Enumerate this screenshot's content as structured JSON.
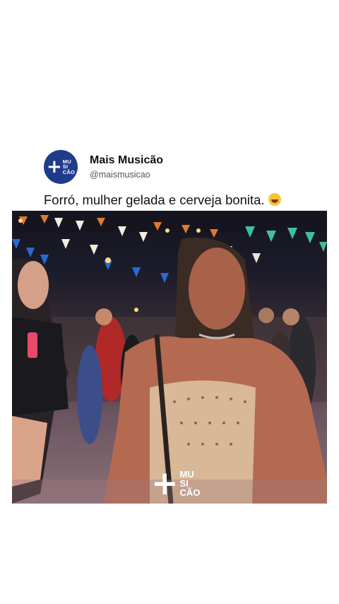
{
  "post": {
    "author_name": "Mais Musicão",
    "author_handle": "@maismusicao",
    "caption": "Forró, mulher gelada e cerveja bonita.",
    "caption_emoji": "laughing-tears-emoji"
  },
  "avatar": {
    "plus": "+",
    "line1": "MU",
    "line2": "SI",
    "line3": "CÃO",
    "color": "#1f3c8c"
  },
  "watermark": {
    "plus": "+",
    "line1": "MU",
    "line2": "SI",
    "line3": "CÃO"
  }
}
